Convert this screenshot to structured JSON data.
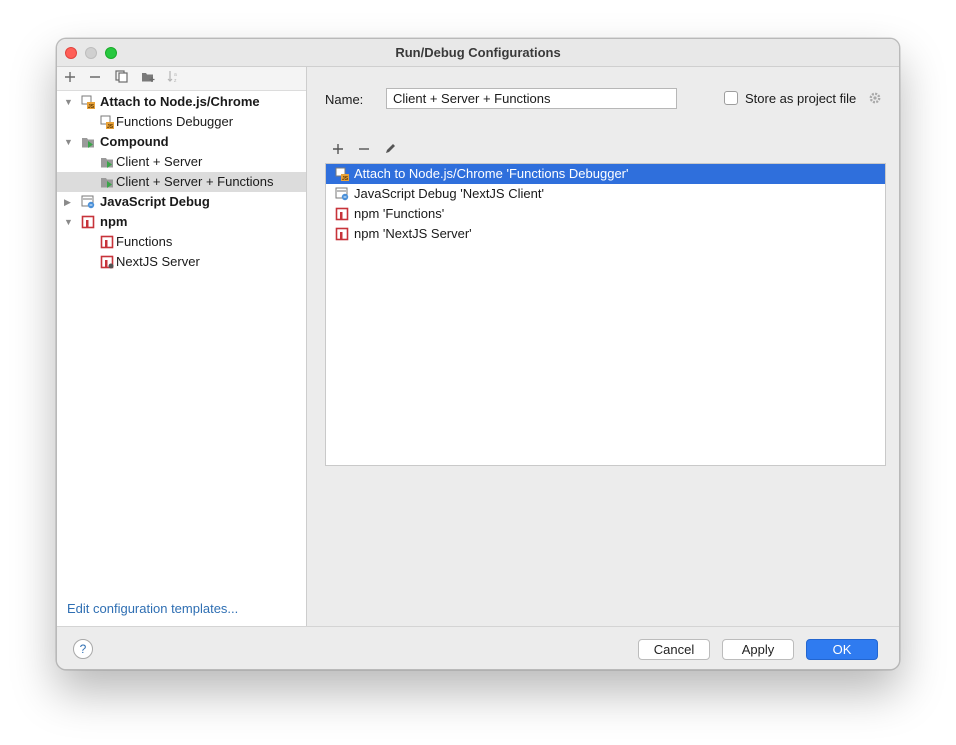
{
  "window": {
    "title": "Run/Debug Configurations"
  },
  "left_toolbar": {
    "add_icon": "plus-icon",
    "remove_icon": "minus-icon",
    "copy_icon": "copy-icon",
    "folder_icon": "new-folder-icon",
    "sort_icon": "sort-icon"
  },
  "tree": {
    "items": [
      {
        "label": "Attach to Node.js/Chrome",
        "type": "group",
        "expanded": true,
        "icon": "attach-node-icon"
      },
      {
        "label": "Functions Debugger",
        "type": "item",
        "icon": "attach-node-icon"
      },
      {
        "label": "Compound",
        "type": "group",
        "expanded": true,
        "icon": "compound-icon"
      },
      {
        "label": "Client + Server",
        "type": "item",
        "icon": "compound-icon"
      },
      {
        "label": "Client + Server + Functions",
        "type": "item",
        "icon": "compound-icon",
        "selected": true
      },
      {
        "label": "JavaScript Debug",
        "type": "group",
        "expanded": false,
        "icon": "js-debug-icon"
      },
      {
        "label": "npm",
        "type": "group",
        "expanded": true,
        "icon": "npm-icon"
      },
      {
        "label": "Functions",
        "type": "item",
        "icon": "npm-icon"
      },
      {
        "label": "NextJS Server",
        "type": "item",
        "icon": "npm-icon"
      }
    ]
  },
  "edit_templates_link": "Edit configuration templates...",
  "form": {
    "name_label": "Name:",
    "name_value": "Client + Server + Functions",
    "store_label": "Store as project file",
    "store_checked": false
  },
  "config_list": {
    "items": [
      {
        "label": "Attach to Node.js/Chrome 'Functions Debugger'",
        "icon": "attach-node-icon",
        "selected": true
      },
      {
        "label": "JavaScript Debug 'NextJS Client'",
        "icon": "js-debug-icon"
      },
      {
        "label": "npm 'Functions'",
        "icon": "npm-icon"
      },
      {
        "label": "npm 'NextJS Server'",
        "icon": "npm-icon"
      }
    ]
  },
  "footer": {
    "help_label": "?",
    "cancel_label": "Cancel",
    "apply_label": "Apply",
    "ok_label": "OK"
  },
  "colors": {
    "accent": "#2f7bf0",
    "selection": "#2f6fdc",
    "link": "#2f6fb3",
    "npm_red": "#c7333a"
  }
}
